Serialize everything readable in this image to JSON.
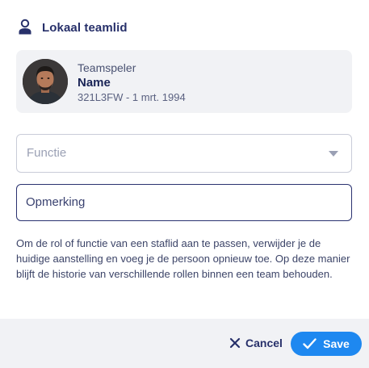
{
  "header": {
    "title": "Lokaal teamlid",
    "icon": "person-pin-icon"
  },
  "player": {
    "role": "Teamspeler",
    "name": "Name",
    "meta": "321L3FW - 1 mrt. 1994"
  },
  "form": {
    "function_placeholder": "Functie",
    "remark_value": "",
    "remark_placeholder": "Opmerking"
  },
  "help_text": "Om de rol of functie van een staflid aan te passen, verwijder je de huidige aanstelling en voeg je de persoon opnieuw toe. Op deze manier blijft de historie van verschillende rollen binnen een team behouden.",
  "footer": {
    "cancel_label": "Cancel",
    "save_label": "Save"
  },
  "colors": {
    "primary": "#1e88f0",
    "navy": "#27306a",
    "panel": "#f1f2f5"
  }
}
